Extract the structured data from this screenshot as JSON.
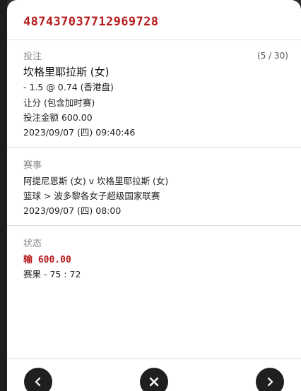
{
  "header": {
    "bet_id": "487437037712969728"
  },
  "bet": {
    "title": "投注",
    "counter": "(5 / 30)",
    "selection": "坎格里耶拉斯 (女)",
    "handicap_odds": "- 1.5 @ 0.74 (香港盘)",
    "market": "让分 (包含加时赛)",
    "stake": "投注金额 600.00",
    "placed_at": "2023/09/07 (四) 09:40:46"
  },
  "event": {
    "title": "赛事",
    "matchup": "阿提尼恩斯 (女) v 坎格里耶拉斯 (女)",
    "league": "篮球 > 波多黎各女子超级国家联赛",
    "start": "2023/09/07 (四) 08:00"
  },
  "status": {
    "title": "状态",
    "result": "输 600.00",
    "score": "赛果 - 75 : 72"
  },
  "footer": {
    "prev_icon": "chevron-left-icon",
    "close_icon": "close-icon",
    "next_icon": "chevron-right-icon"
  },
  "colors": {
    "accent": "#b71c1c",
    "button": "#1f1f1f"
  }
}
